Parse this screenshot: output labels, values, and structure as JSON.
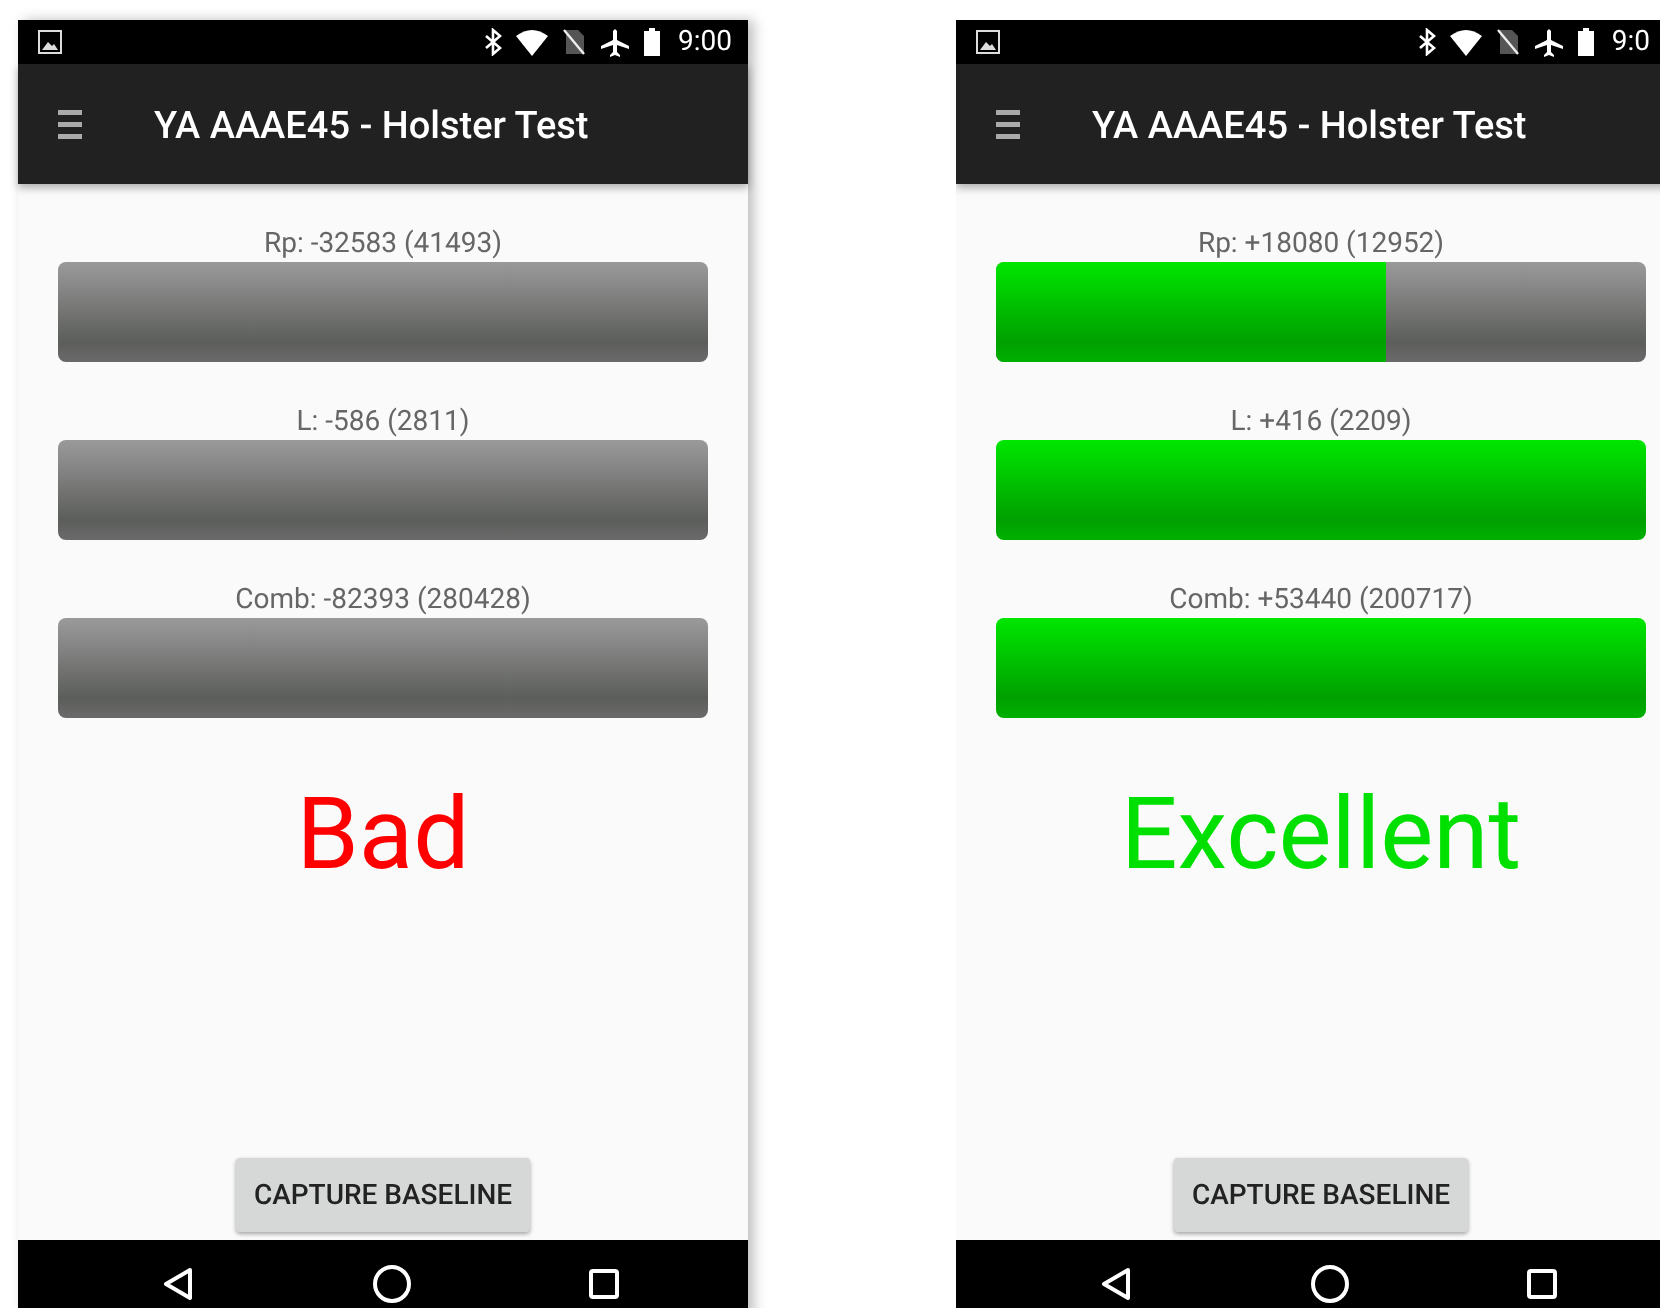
{
  "screens": [
    {
      "status_bar": {
        "time": "9:00"
      },
      "toolbar": {
        "title": "YA AAAE45 - Holster Test"
      },
      "meters": [
        {
          "label": "Rp: -32583 (41493)",
          "level": 0
        },
        {
          "label": "L: -586 (2811)",
          "level": 0
        },
        {
          "label": "Comb: -82393 (280428)",
          "level": 0
        }
      ],
      "rating": {
        "text": "Bad",
        "color": "#ff0000"
      },
      "button": "CAPTURE BASELINE"
    },
    {
      "status_bar": {
        "time": "9:0"
      },
      "toolbar": {
        "title": "YA AAAE45 - Holster Test"
      },
      "meters": [
        {
          "label": "Rp: +18080 (12952)",
          "level": 0.6
        },
        {
          "label": "L: +416 (2209)",
          "level": 1
        },
        {
          "label": "Comb: +53440 (200717)",
          "level": 1
        }
      ],
      "rating": {
        "text": "Excellent",
        "color": "#00e000"
      },
      "button": "CAPTURE BASELINE"
    }
  ]
}
